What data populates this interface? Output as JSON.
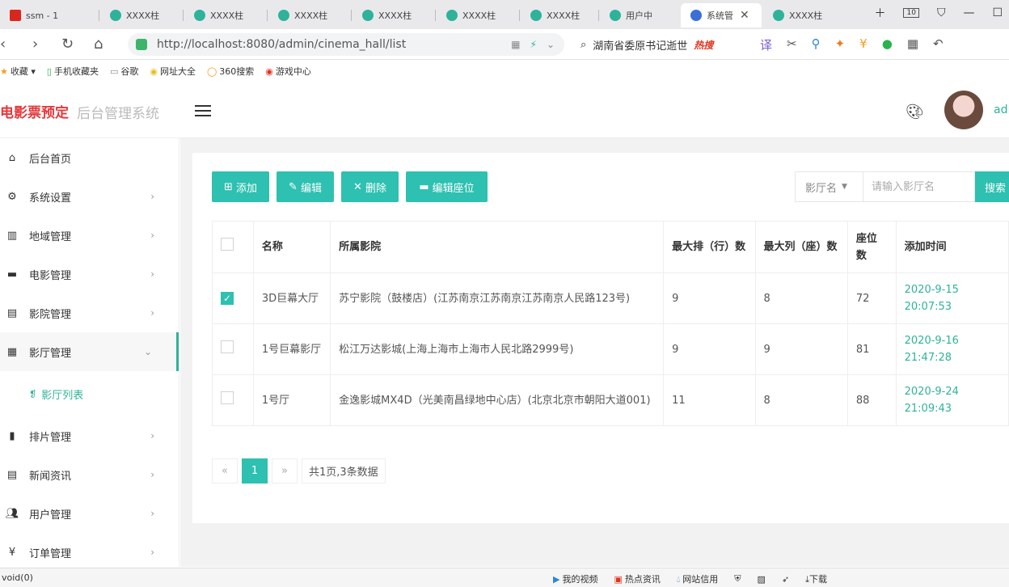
{
  "browser": {
    "tabs": [
      {
        "label": "ssm - 1",
        "active": false
      },
      {
        "label": "XXXX柱",
        "active": false
      },
      {
        "label": "XXXX柱",
        "active": false
      },
      {
        "label": "XXXX柱",
        "active": false
      },
      {
        "label": "XXXX柱",
        "active": false
      },
      {
        "label": "XXXX柱",
        "active": false
      },
      {
        "label": "XXXX柱",
        "active": false
      },
      {
        "label": "用户中",
        "active": false
      },
      {
        "label": "系统管",
        "active": true
      },
      {
        "label": "XXXX柱",
        "active": false
      }
    ],
    "tab_count": "10",
    "url": "http://localhost:8080/admin/cinema_hall/list",
    "search_hint": "湖南省委原书记逝世",
    "search_hot": "热搜",
    "bookmarks": [
      "收藏",
      "手机收藏夹",
      "谷歌",
      "网址大全",
      "360搜索",
      "游戏中心"
    ]
  },
  "app": {
    "brand": "电影票预定",
    "brand_sub": "后台管理系统",
    "username": "ad"
  },
  "sidebar": {
    "items": [
      {
        "label": "后台首页",
        "icon": "home-icon"
      },
      {
        "label": "系统设置",
        "icon": "gear-icon"
      },
      {
        "label": "地域管理",
        "icon": "map-icon"
      },
      {
        "label": "电影管理",
        "icon": "film-icon"
      },
      {
        "label": "影院管理",
        "icon": "cinema-icon"
      },
      {
        "label": "影厅管理",
        "icon": "hall-icon"
      },
      {
        "label": "排片管理",
        "icon": "schedule-icon"
      },
      {
        "label": "新闻资讯",
        "icon": "news-icon"
      },
      {
        "label": "用户管理",
        "icon": "users-icon"
      },
      {
        "label": "订单管理",
        "icon": "yen-icon"
      }
    ],
    "sub_item": "影厅列表"
  },
  "toolbar": {
    "add": "添加",
    "edit": "编辑",
    "delete": "删除",
    "edit_seats": "编辑座位",
    "filter_field": "影厅名",
    "filter_placeholder": "请输入影厅名",
    "search": "搜索"
  },
  "table": {
    "headers": [
      "名称",
      "所属影院",
      "最大排（行）数",
      "最大列（座）数",
      "座位数",
      "添加时间"
    ],
    "rows": [
      {
        "checked": true,
        "name": "3D巨幕大厅",
        "cinema": "苏宁影院（鼓楼店）(江苏南京江苏南京江苏南京人民路123号)",
        "max_rows": "9",
        "max_cols": "8",
        "seats": "72",
        "time": "2020-9-15 20:07:53"
      },
      {
        "checked": false,
        "name": "1号巨幕影厅",
        "cinema": "松江万达影城(上海上海市上海市人民北路2999号)",
        "max_rows": "9",
        "max_cols": "9",
        "seats": "81",
        "time": "2020-9-16 21:47:28"
      },
      {
        "checked": false,
        "name": "1号厅",
        "cinema": "金逸影城MX4D（光美南昌绿地中心店）(北京北京市朝阳大道001)",
        "max_rows": "11",
        "max_cols": "8",
        "seats": "88",
        "time": "2020-9-24 21:09:43"
      }
    ]
  },
  "pager": {
    "prev": "«",
    "current": "1",
    "next": "»",
    "info": "共1页,3条数据"
  },
  "statusbar": {
    "left": "void(0)",
    "items": [
      "我的视频",
      "热点资讯",
      "网站信用",
      "下载"
    ]
  }
}
